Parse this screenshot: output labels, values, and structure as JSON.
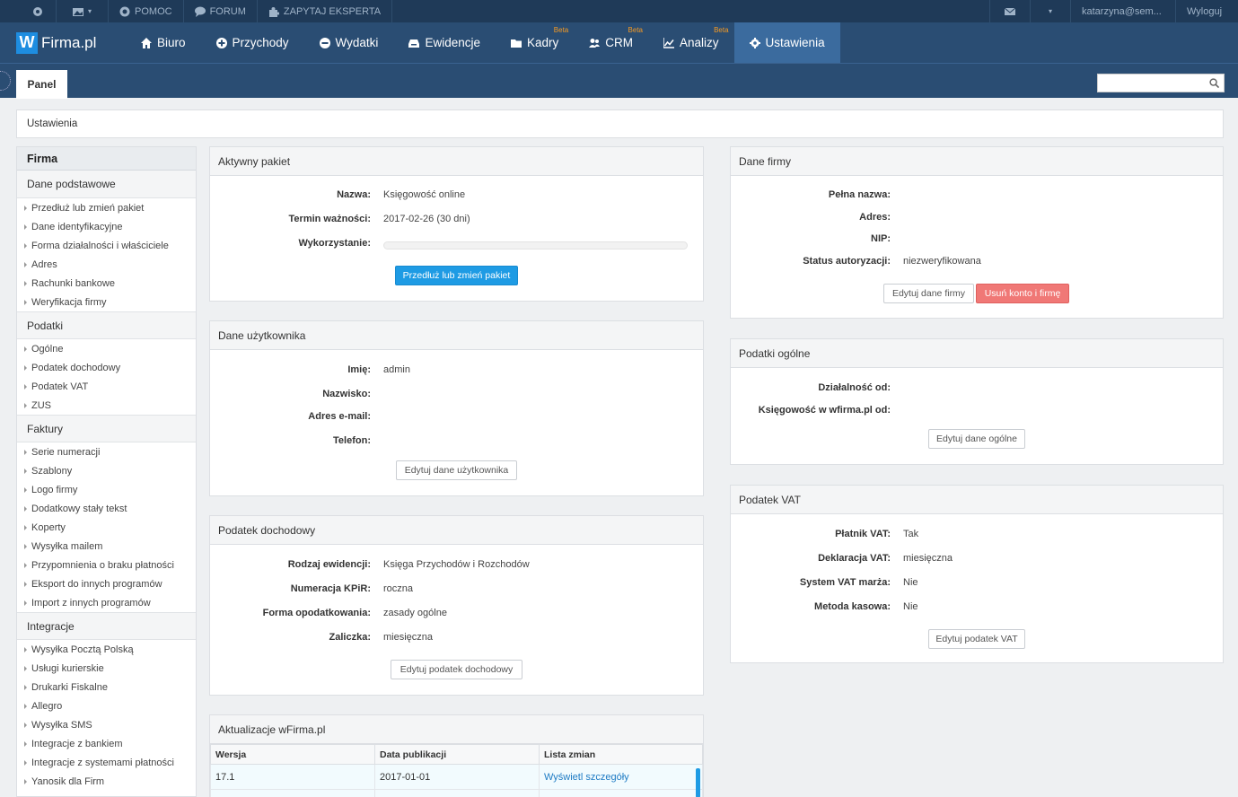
{
  "topbar": {
    "help": "POMOC",
    "forum": "FORUM",
    "ask_expert": "ZAPYTAJ EKSPERTA",
    "user": "katarzyna@sem...",
    "logout": "Wyloguj"
  },
  "logo": {
    "letter": "W",
    "name": "Firma.pl"
  },
  "nav": {
    "items": [
      {
        "label": "Biuro",
        "beta": ""
      },
      {
        "label": "Przychody",
        "beta": ""
      },
      {
        "label": "Wydatki",
        "beta": ""
      },
      {
        "label": "Ewidencje",
        "beta": ""
      },
      {
        "label": "Kadry",
        "beta": "Beta"
      },
      {
        "label": "CRM",
        "beta": "Beta"
      },
      {
        "label": "Analizy",
        "beta": "Beta"
      },
      {
        "label": "Ustawienia",
        "beta": ""
      }
    ]
  },
  "subnav": {
    "panel": "Panel",
    "search_placeholder": ""
  },
  "breadcrumb": "Ustawienia",
  "sidebar": {
    "header": "Firma",
    "sections": [
      {
        "title": "Dane podstawowe",
        "items": [
          "Przedłuż lub zmień pakiet",
          "Dane identyfikacyjne",
          "Forma działalności i właściciele",
          "Adres",
          "Rachunki bankowe",
          "Weryfikacja firmy"
        ]
      },
      {
        "title": "Podatki",
        "items": [
          "Ogólne",
          "Podatek dochodowy",
          "Podatek VAT",
          "ZUS"
        ]
      },
      {
        "title": "Faktury",
        "items": [
          "Serie numeracji",
          "Szablony",
          "Logo firmy",
          "Dodatkowy stały tekst",
          "Koperty",
          "Wysyłka mailem",
          "Przypomnienia o braku płatności",
          "Eksport do innych programów",
          "Import z innych programów"
        ]
      },
      {
        "title": "Integracje",
        "items": [
          "Wysyłka Pocztą Polską",
          "Usługi kurierskie",
          "Drukarki Fiskalne",
          "Allegro",
          "Wysyłka SMS",
          "Integracje z bankiem",
          "Integracje z systemami płatności",
          "Yanosik dla Firm"
        ]
      }
    ]
  },
  "package": {
    "title": "Aktywny pakiet",
    "name_label": "Nazwa:",
    "name_value": "Księgowość online",
    "term_label": "Termin ważności:",
    "term_value": "2017-02-26 (30 dni)",
    "usage_label": "Wykorzystanie:",
    "usage_fraction": 0.0,
    "button": "Przedłuż lub zmień pakiet"
  },
  "user": {
    "title": "Dane użytkownika",
    "first_label": "Imię:",
    "first_value": "admin",
    "last_label": "Nazwisko:",
    "email_label": "Adres e-mail:",
    "phone_label": "Telefon:",
    "button": "Edytuj dane użytkownika"
  },
  "income_tax": {
    "title": "Podatek dochodowy",
    "type_label": "Rodzaj ewidencji:",
    "type_value": "Księga Przychodów i Rozchodów",
    "num_label": "Numeracja KPiR:",
    "num_value": "roczna",
    "form_label": "Forma opodatkowania:",
    "form_value": "zasady ogólne",
    "adv_label": "Zaliczka:",
    "adv_value": "miesięczna",
    "button": "Edytuj podatek dochodowy"
  },
  "updates": {
    "title": "Aktualizacje wFirma.pl",
    "col_version": "Wersja",
    "col_date": "Data publikacji",
    "col_changes": "Lista zmian",
    "rows": [
      {
        "version": "17.1",
        "date": "2017-01-01",
        "link": "Wyświetl szczegóły"
      }
    ]
  },
  "company": {
    "title": "Dane firmy",
    "full_label": "Pełna nazwa:",
    "addr_label": "Adres:",
    "nip_label": "NIP:",
    "status_label": "Status autoryzacji:",
    "status_value": "niezweryfikowana",
    "edit_button": "Edytuj dane firmy",
    "delete_button": "Usuń konto i firmę"
  },
  "general_tax": {
    "title": "Podatki ogólne",
    "since_label": "Działalność od:",
    "acc_label": "Księgowość w wfirma.pl od:",
    "button": "Edytuj dane ogólne"
  },
  "vat": {
    "title": "Podatek VAT",
    "payer_label": "Płatnik VAT:",
    "payer_value": "Tak",
    "decl_label": "Deklaracja VAT:",
    "decl_value": "miesięczna",
    "margin_label": "System VAT marża:",
    "margin_value": "Nie",
    "cash_label": "Metoda kasowa:",
    "cash_value": "Nie",
    "button": "Edytuj podatek VAT"
  }
}
